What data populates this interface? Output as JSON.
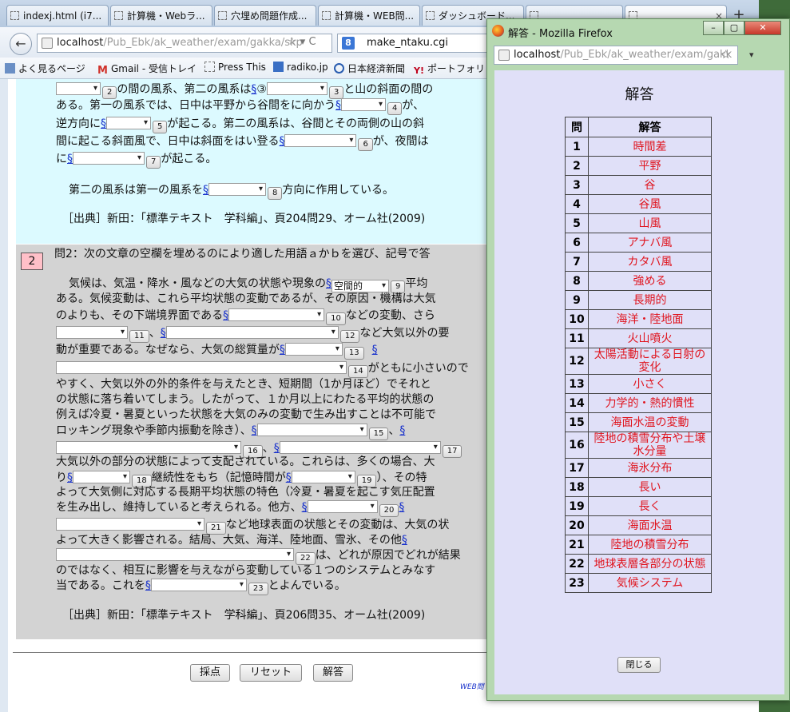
{
  "browser": {
    "tabs": [
      {
        "label": "indexj.html (i7..."
      },
      {
        "label": "計算機・Webラ..."
      },
      {
        "label": "穴埋め問題作成..."
      },
      {
        "label": "計算機・WEB問..."
      },
      {
        "label": "ダッシュボード..."
      },
      {
        "label": ""
      },
      {
        "label": "×"
      }
    ],
    "new_tab": "+",
    "back": "←",
    "url_host": "localhost",
    "url_path": "/Pub_Ebk/ak_weather/exam/gakka/skp",
    "url_star": "☆ ▾ C",
    "search_text": "make_ntaku.cgi",
    "search_icon": "8",
    "bookmarks": [
      "よく見るページ",
      "Gmail - 受信トレイ",
      "Press This",
      "radiko.jp",
      "日本経済新聞",
      "ポートフォリ"
    ]
  },
  "q1": {
    "l1_a": "の間の風系、第二の風系は",
    "l1_b": "③",
    "l1_c": "と山の斜面の間の",
    "l2_a": "ある。第一の風系では、日中は平野から谷間をに向かう",
    "l2_b": "が、",
    "l3_a": "逆方向に",
    "l3_b": "が起こる。第二の風系は、谷間とその両側の山の斜",
    "l4_a": "間に起こる斜面風で、日中は斜面をはい登る",
    "l4_b": "が、夜間は",
    "l5_a": "に",
    "l5_b": "が起こる。",
    "l6_a": "第二の風系は第一の風系を",
    "l6_b": "方向に作用している。",
    "source": "［出典］新田：「標準テキスト　学科編」、頁204問29、オーム社(2009)"
  },
  "q2": {
    "badge": "2",
    "prompt": "問2：次の文章の空欄を埋めるのにより適した用語ａかｂを選び、記号で答",
    "l1_a": "気候は、気温・降水・風などの大気の状態や現象の",
    "l1_sel": "空間的",
    "l1_b": "平均",
    "l2": "ある。気候変動は、これら平均状態の変動であるが、その原因・機構は大気",
    "l3_a": "のよりも、その下端境界面である",
    "l3_b": "などの変動、さら",
    "l4_a": "、",
    "l4_b": "など大気以外の要",
    "l5_a": "動が重要である。なぜなら、大気の総質量が",
    "l6_b": "がともに小さいので",
    "l7": "やすく、大気以外の外的条件を与えたとき、短期間（1か月ほど）でそれと",
    "l8": "の状態に落ち着いてしまう。したがって、１か月以上にわたる平均的状態の",
    "l9": "例えば冷夏・暑夏といった状態を大気のみの変動で生み出すことは不可能で",
    "l10_a": "ロッキング現象や季節内振動を除き）、",
    "l10_b": "、",
    "l11_a": "、",
    "l12": "大気以外の部分の状態によって支配されている。これらは、多くの場合、大",
    "l13_a": "り",
    "l13_b": "継続性をもち（記憶時間が",
    "l13_c": "）、その特",
    "l14": "よって大気側に対応する長期平均状態の特色（冷夏・暑夏を起こす気圧配置",
    "l15_a": "を生み出し、維持していると考えられる。他方、",
    "l16_a": "など地球表面の状態とその変動は、大気の状",
    "l17_a": "よって大きく影響される。結局、大気、海洋、陸地面、雪氷、その他",
    "l18_a": "は、どれが原因でどれが結果",
    "l19": "のではなく、相互に影響を与えながら変動している１つのシステムとみなす",
    "l20_a": "当である。これを",
    "l20_b": "とよんでいる。",
    "source": "［出典］新田：「標準テキスト　学科編」、頁206問35、オーム社(2009)"
  },
  "sect_mark": "§",
  "blank_numbers": [
    "2",
    "3",
    "4",
    "5",
    "6",
    "7",
    "8",
    "9",
    "10",
    "11",
    "12",
    "13",
    "14",
    "15",
    "16",
    "17",
    "18",
    "19",
    "20",
    "21",
    "22",
    "23"
  ],
  "buttons": {
    "grade": "採点",
    "reset": "リセット",
    "answer": "解答"
  },
  "web_link": "WEB問",
  "popup": {
    "title": "解答 - Mozilla Firefox",
    "url_host": "localhost",
    "url_path": "/Pub_Ebk/ak_weather/exam/gakk",
    "min": "–",
    "max": "▢",
    "close": "✕",
    "heading": "解答",
    "col_q": "問",
    "col_a": "解答",
    "rows": [
      {
        "n": "1",
        "a": "時間差"
      },
      {
        "n": "2",
        "a": "平野"
      },
      {
        "n": "3",
        "a": "谷"
      },
      {
        "n": "4",
        "a": "谷風"
      },
      {
        "n": "5",
        "a": "山風"
      },
      {
        "n": "6",
        "a": "アナバ風"
      },
      {
        "n": "7",
        "a": "カタバ風"
      },
      {
        "n": "8",
        "a": "強める"
      },
      {
        "n": "9",
        "a": "長期的"
      },
      {
        "n": "10",
        "a": "海洋・陸地面"
      },
      {
        "n": "11",
        "a": "火山噴火"
      },
      {
        "n": "12",
        "a": "太陽活動による日射の変化"
      },
      {
        "n": "13",
        "a": "小さく"
      },
      {
        "n": "14",
        "a": "力学的・熱的慣性"
      },
      {
        "n": "15",
        "a": "海面水温の変動"
      },
      {
        "n": "16",
        "a": "陸地の積雪分布や土壌水分量"
      },
      {
        "n": "17",
        "a": "海氷分布"
      },
      {
        "n": "18",
        "a": "長い"
      },
      {
        "n": "19",
        "a": "長く"
      },
      {
        "n": "20",
        "a": "海面水温"
      },
      {
        "n": "21",
        "a": "陸地の積雪分布"
      },
      {
        "n": "22",
        "a": "地球表層各部分の状態"
      },
      {
        "n": "23",
        "a": "気候システム"
      }
    ],
    "close_button": "閉じる"
  }
}
